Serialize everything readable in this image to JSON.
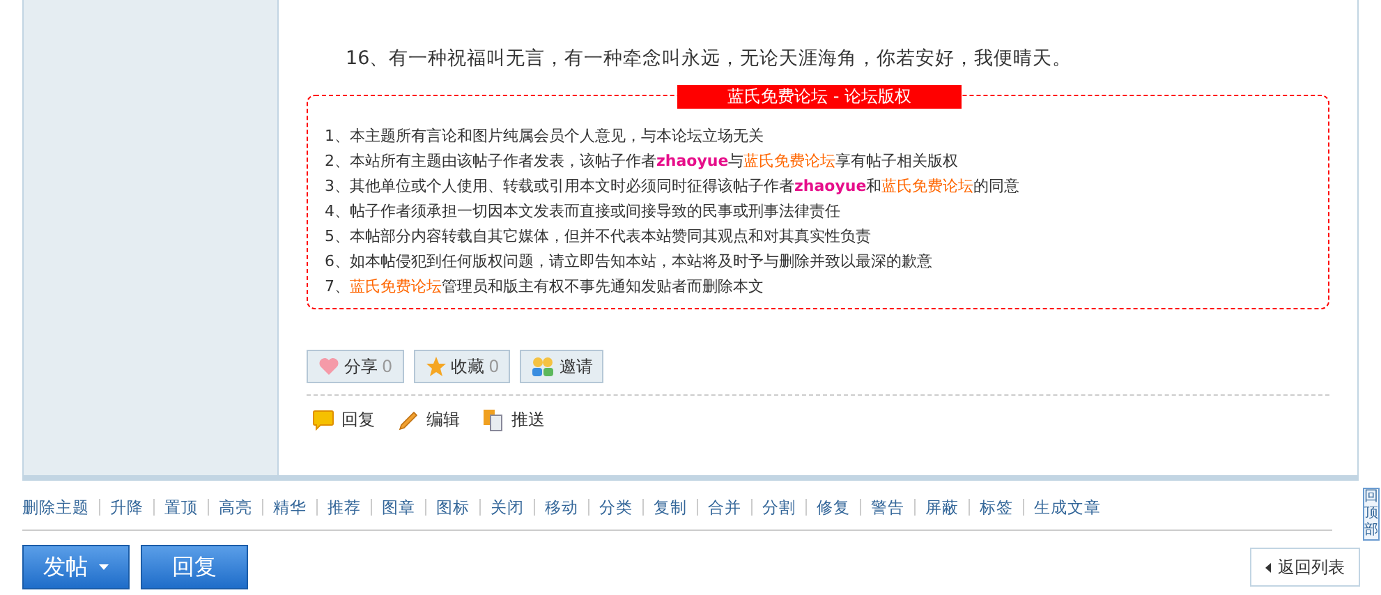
{
  "post": {
    "paragraphs": [
      "16、有一种祝福叫无言，有一种牵念叫永远，无论天涯海角，你若安好，我便晴天。"
    ],
    "copyright": {
      "title": "蓝氏免费论坛 - 论坛版权",
      "items": [
        [
          {
            "kind": "plain",
            "text": "1、本主题所有言论和图片纯属会员个人意见，与本论坛立场无关"
          }
        ],
        [
          {
            "kind": "plain",
            "text": "2、本站所有主题由该帖子作者发表，该帖子作者"
          },
          {
            "kind": "user",
            "text": "zhaoyue"
          },
          {
            "kind": "plain",
            "text": "与"
          },
          {
            "kind": "site",
            "text": "蓝氏免费论坛"
          },
          {
            "kind": "plain",
            "text": "享有帖子相关版权"
          }
        ],
        [
          {
            "kind": "plain",
            "text": "3、其他单位或个人使用、转载或引用本文时必须同时征得该帖子作者"
          },
          {
            "kind": "user",
            "text": "zhaoyue"
          },
          {
            "kind": "plain",
            "text": "和"
          },
          {
            "kind": "site",
            "text": "蓝氏免费论坛"
          },
          {
            "kind": "plain",
            "text": "的同意"
          }
        ],
        [
          {
            "kind": "plain",
            "text": "4、帖子作者须承担一切因本文发表而直接或间接导致的民事或刑事法律责任"
          }
        ],
        [
          {
            "kind": "plain",
            "text": "5、本帖部分内容转载自其它媒体，但并不代表本站赞同其观点和对其真实性负责"
          }
        ],
        [
          {
            "kind": "plain",
            "text": "6、如本帖侵犯到任何版权问题，请立即告知本站，本站将及时予与删除并致以最深的歉意"
          }
        ],
        [
          {
            "kind": "plain",
            "text": "7、"
          },
          {
            "kind": "site",
            "text": "蓝氏免费论坛"
          },
          {
            "kind": "plain",
            "text": "管理员和版主有权不事先通知发贴者而删除本文"
          }
        ]
      ]
    },
    "share_buttons": [
      {
        "kind": "heart",
        "label": "分享",
        "count": "0"
      },
      {
        "kind": "star",
        "label": "收藏",
        "count": "0"
      },
      {
        "kind": "people",
        "label": "邀请"
      }
    ],
    "actions": [
      {
        "kind": "reply",
        "label": "回复"
      },
      {
        "kind": "edit",
        "label": "编辑"
      },
      {
        "kind": "push",
        "label": "推送"
      }
    ]
  },
  "mod_links": [
    "删除主题",
    "升降",
    "置顶",
    "高亮",
    "精华",
    "推荐",
    "图章",
    "图标",
    "关闭",
    "移动",
    "分类",
    "复制",
    "合并",
    "分割",
    "修复",
    "警告",
    "屏蔽",
    "标签",
    "生成文章"
  ],
  "bottom": {
    "post_button": "发帖",
    "reply_button": "回复",
    "back_button": "返回列表",
    "top_tab": "回顶部"
  }
}
